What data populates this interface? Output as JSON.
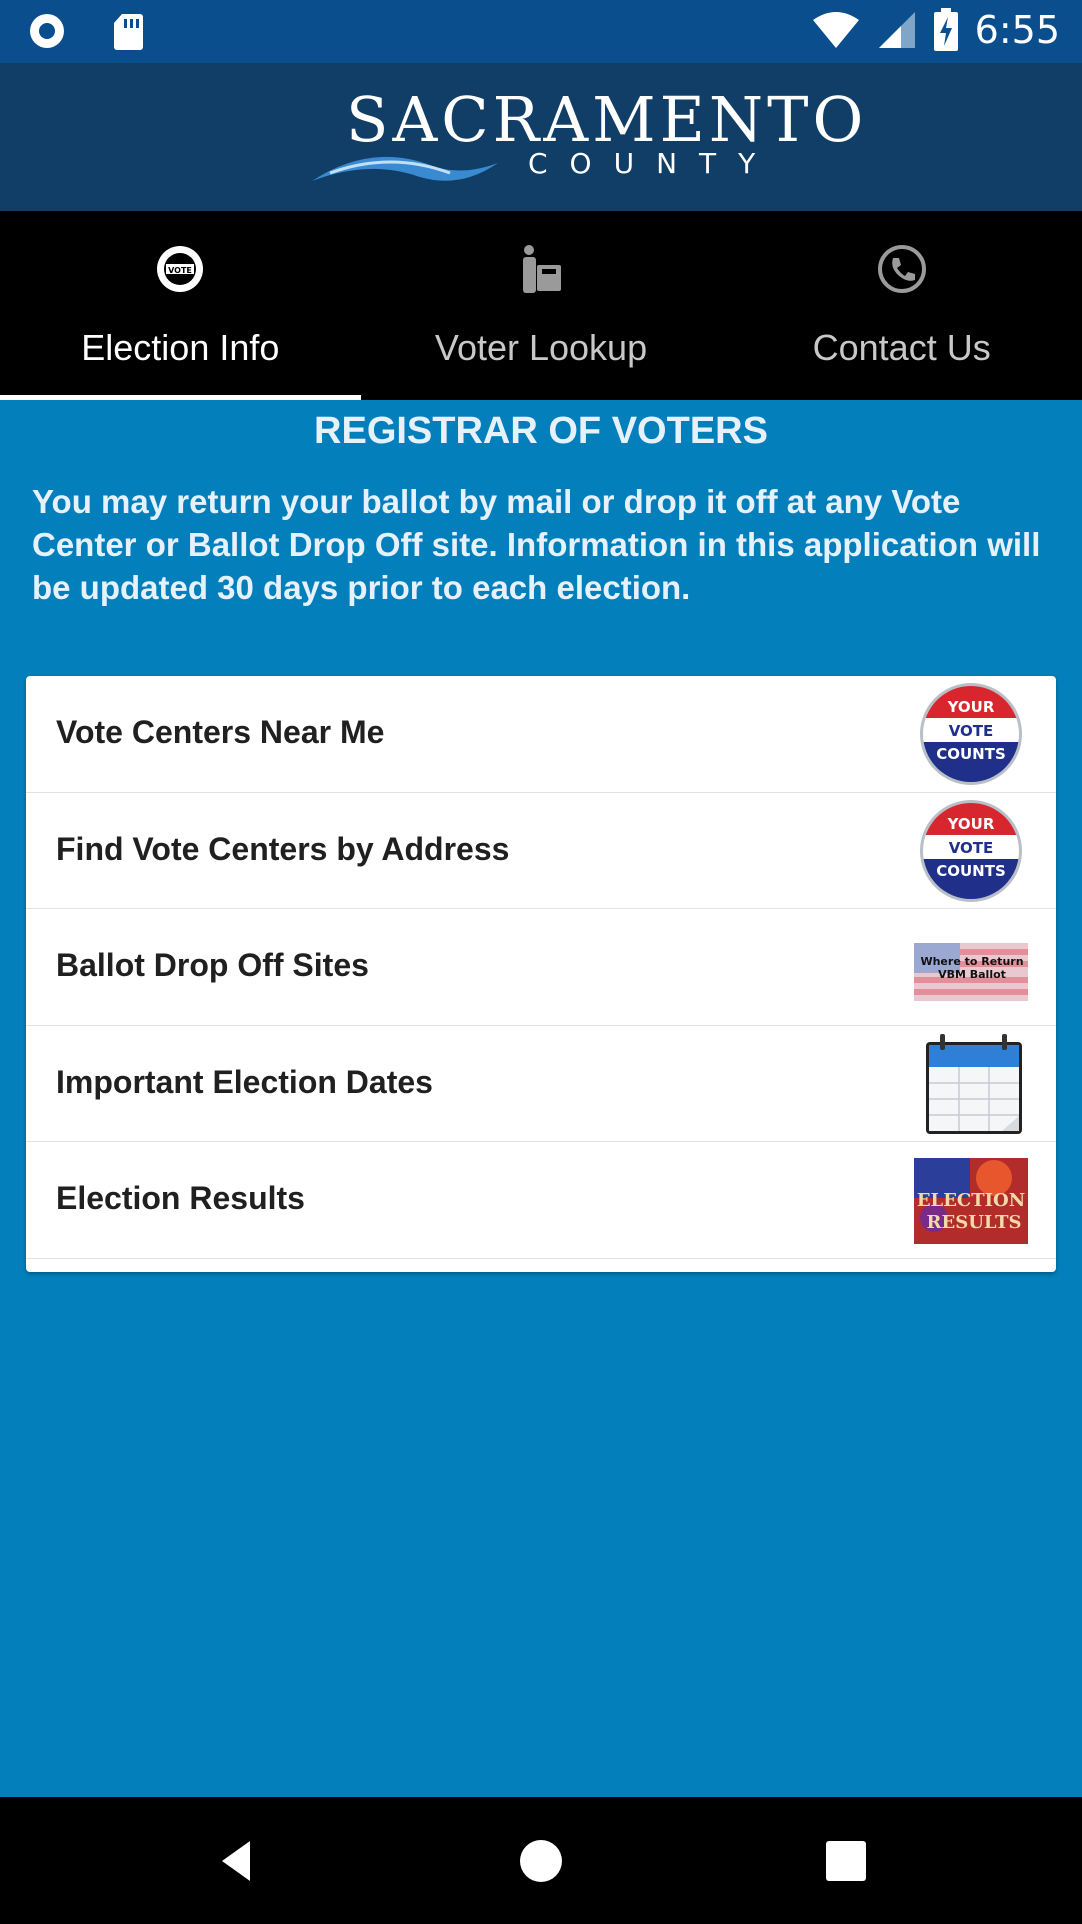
{
  "status_bar": {
    "time": "6:55",
    "left_icons": [
      "record-icon",
      "sd-card-icon"
    ],
    "right_icons": [
      "wifi-icon",
      "cell-signal-icon",
      "battery-charging-icon"
    ]
  },
  "header": {
    "logo_word": "SACRAMENTO",
    "logo_sub": "COUNTY"
  },
  "tabs": [
    {
      "label": "Election Info",
      "icon": "vote-badge-icon",
      "active": true
    },
    {
      "label": "Voter Lookup",
      "icon": "voter-ballot-icon",
      "active": false
    },
    {
      "label": "Contact Us",
      "icon": "phone-icon",
      "active": false
    }
  ],
  "main": {
    "title": "REGISTRAR OF VOTERS",
    "intro": "You may return your ballot by mail or drop it off at any Vote Center or Ballot Drop Off site. Information in this application will be updated 30 days prior to each election.",
    "items": [
      {
        "label": "Vote Centers Near Me",
        "thumb": "your-vote-counts-button"
      },
      {
        "label": "Find Vote Centers by Address",
        "thumb": "your-vote-counts-button"
      },
      {
        "label": "Ballot Drop Off Sites",
        "thumb": "vbm-ballot-flag",
        "thumb_text": "Where to Return VBM Ballot"
      },
      {
        "label": "Important Election Dates",
        "thumb": "calendar-icon"
      },
      {
        "label": "Election Results",
        "thumb": "election-results-banner",
        "thumb_text": "ELECTION RESULTS"
      }
    ],
    "badge_text": [
      "YOUR",
      "VOTE",
      "COUNTS"
    ]
  },
  "colors": {
    "status_bar": "#0a4e8e",
    "header": "#103e66",
    "tabs": "#000000",
    "background": "#0380bc",
    "card": "#ffffff"
  },
  "nav": [
    "back-icon",
    "home-icon",
    "recents-icon"
  ]
}
